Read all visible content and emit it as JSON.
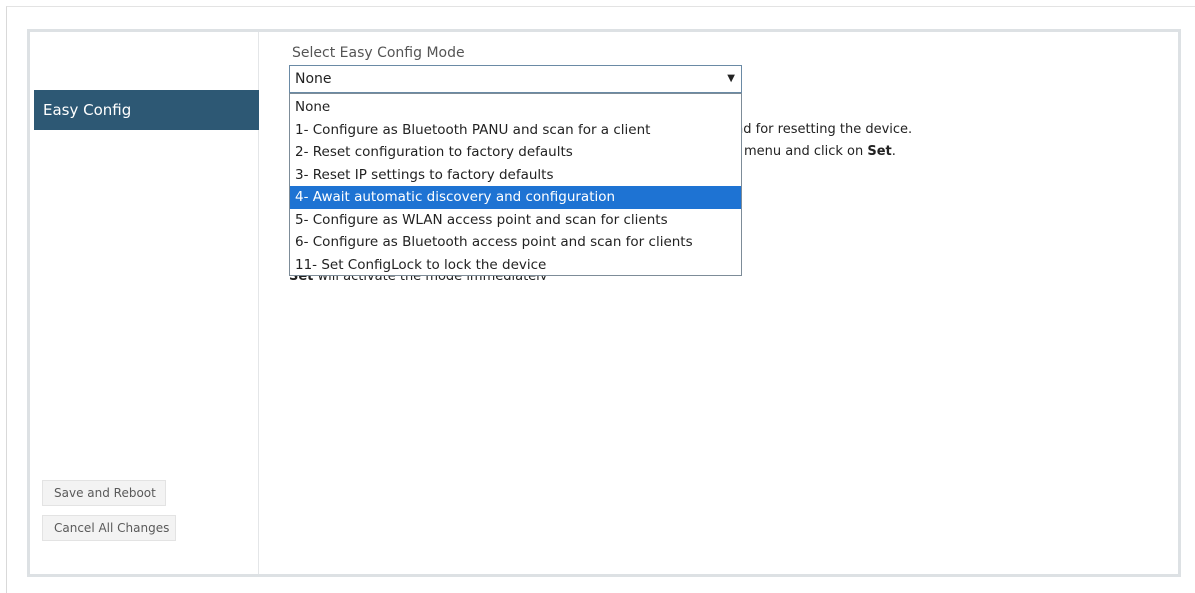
{
  "sidebar": {
    "active_item": "Easy Config",
    "save_button": "Save and Reboot",
    "cancel_button": "Cancel All Changes"
  },
  "main": {
    "select_label": "Select Easy Config Mode",
    "selected_value": "None",
    "options": [
      "None",
      "1- Configure as Bluetooth PANU and scan for a client",
      "2- Reset configuration to factory defaults",
      "3- Reset IP settings to factory defaults",
      "4- Await automatic discovery and configuration",
      "5- Configure as WLAN access point and scan for clients",
      "6- Configure as Bluetooth access point and scan for clients",
      "11- Set ConfigLock to lock the device"
    ],
    "highlighted_option": "4- Await automatic discovery and configuration",
    "partial_text_1": "nd for resetting the device.",
    "partial_text_2_prefix": " menu and click on ",
    "partial_text_2_bold": "Set",
    "partial_text_2_suffix": ".",
    "partial_text_3_bold": "Set",
    "partial_text_3_rest": " will activate the mode immediately"
  },
  "colors": {
    "sidebar_active": "#2d5874",
    "option_highlight": "#1e73d3",
    "panel_border": "#dde1e4"
  }
}
